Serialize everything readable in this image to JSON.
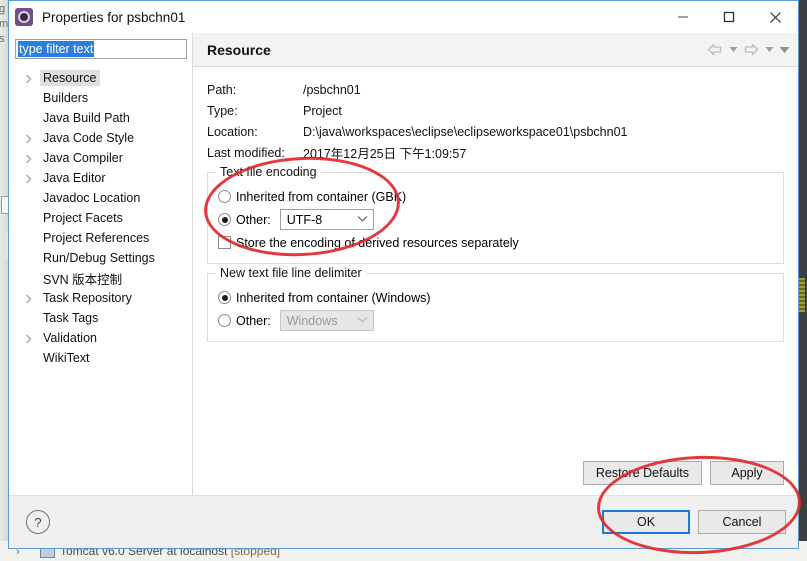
{
  "background": {
    "left_text": "g\nm\ns",
    "bottom_status": "Tomcat v6.0 Server at localhost",
    "bottom_status_state": "[stopped]",
    "bottom_icons": "›"
  },
  "window": {
    "title": "Properties for psbchn01",
    "icon": "eclipse-properties-icon",
    "controls": {
      "minimize": "minimize-icon",
      "maximize": "maximize-icon",
      "close": "close-icon"
    }
  },
  "sidebar": {
    "filter": {
      "value": "type filter text",
      "placeholder": "type filter text"
    },
    "items": [
      {
        "label": "Resource",
        "expandable": true,
        "selected": true
      },
      {
        "label": "Builders",
        "expandable": false,
        "selected": false
      },
      {
        "label": "Java Build Path",
        "expandable": false,
        "selected": false
      },
      {
        "label": "Java Code Style",
        "expandable": true,
        "selected": false
      },
      {
        "label": "Java Compiler",
        "expandable": true,
        "selected": false
      },
      {
        "label": "Java Editor",
        "expandable": true,
        "selected": false
      },
      {
        "label": "Javadoc Location",
        "expandable": false,
        "selected": false
      },
      {
        "label": "Project Facets",
        "expandable": false,
        "selected": false
      },
      {
        "label": "Project References",
        "expandable": false,
        "selected": false
      },
      {
        "label": "Run/Debug Settings",
        "expandable": false,
        "selected": false
      },
      {
        "label": "SVN 版本控制",
        "expandable": false,
        "selected": false
      },
      {
        "label": "Task Repository",
        "expandable": true,
        "selected": false
      },
      {
        "label": "Task Tags",
        "expandable": false,
        "selected": false
      },
      {
        "label": "Validation",
        "expandable": true,
        "selected": false
      },
      {
        "label": "WikiText",
        "expandable": false,
        "selected": false
      }
    ]
  },
  "page": {
    "title": "Resource",
    "nav": {
      "back": "back-arrow-icon",
      "back_menu": "chevron-down-icon",
      "forward": "forward-arrow-icon",
      "forward_menu": "chevron-down-icon",
      "view_menu": "chevron-down-icon"
    },
    "info": [
      {
        "key": "Path:",
        "key_mnemonic": "P",
        "value": "/psbchn01"
      },
      {
        "key": "Type:",
        "key_mnemonic": "y",
        "value": "Project"
      },
      {
        "key": "Location:",
        "key_mnemonic": "L",
        "value": "D:\\java\\workspaces\\eclipse\\eclipseworkspace01\\psbchn01"
      },
      {
        "key": "Last modified:",
        "key_mnemonic": "m",
        "value": "2017年12月25日 下午1:09:57"
      }
    ],
    "encoding_group": {
      "legend": "Text file encoding",
      "inherited_label": "Inherited from container (GBK)",
      "inherited_checked": false,
      "other_label": "Other:",
      "other_checked": true,
      "other_value": "UTF-8",
      "store_derived_label": "Store the encoding of derived resources separately",
      "store_derived_checked": false
    },
    "delimiter_group": {
      "legend": "New text file line delimiter",
      "inherited_label": "Inherited from container (Windows)",
      "inherited_checked": true,
      "other_label": "Other:",
      "other_checked": false,
      "other_value": "Windows",
      "other_disabled": true
    },
    "buttons": {
      "restore_defaults": "Restore Defaults",
      "apply": "Apply"
    }
  },
  "footer": {
    "help": "?",
    "ok": "OK",
    "cancel": "Cancel"
  },
  "annotations": [
    {
      "name": "encoding-highlight",
      "shape": "ellipse",
      "color": "#e2282c"
    },
    {
      "name": "ok-highlight",
      "shape": "ellipse",
      "color": "#e2282c"
    }
  ]
}
